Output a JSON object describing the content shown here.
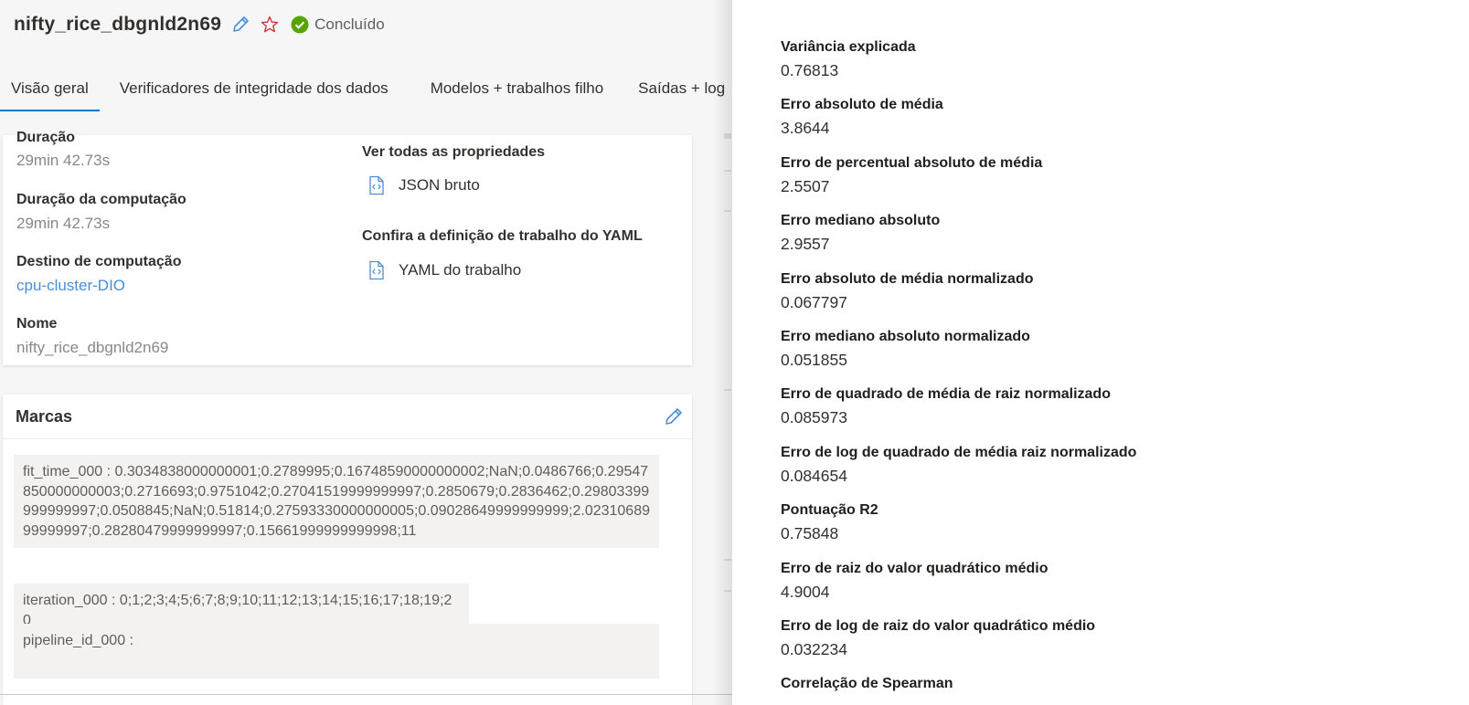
{
  "header": {
    "title": "nifty_rice_dbgnld2n69",
    "status": "Concluído",
    "edit_icon": "pencil-icon",
    "favorite_icon": "star-icon",
    "status_icon": "check-circle-icon",
    "colors": {
      "accent": "#0078d4",
      "link": "#4a8fd8",
      "success": "#57a300",
      "star": "#d13438"
    }
  },
  "tabs": [
    {
      "label": "Visão geral",
      "active": true
    },
    {
      "label": "Verificadores de integridade dos dados"
    },
    {
      "label": "Modelos + trabalhos filho"
    },
    {
      "label": "Saídas + log"
    }
  ],
  "properties": {
    "duration_label": "Duração",
    "duration_value": "29min 42.73s",
    "compute_duration_label": "Duração da computação",
    "compute_duration_value": "29min 42.73s",
    "compute_target_label": "Destino de computação",
    "compute_target_value": "cpu-cluster-DIO",
    "name_label": "Nome",
    "name_value": "nifty_rice_dbgnld2n69",
    "see_all_label": "Ver todas as propriedades",
    "raw_json_label": "JSON bruto",
    "yaml_heading": "Confira a definição de trabalho do YAML",
    "yaml_link_label": "YAML do trabalho"
  },
  "tags": {
    "heading": "Marcas",
    "items": [
      "fit_time_000 : 0.3034838000000001;0.2789995;0.16748590000000002;NaN;0.0486766;0.29547850000000003;0.2716693;0.9751042;0.27041519999999997;0.2850679;0.2836462;0.29803399999999997;0.0508845;NaN;0.51814;0.27593330000000005;0.09028649999999999;2.0231068999999997;0.28280479999999997;0.15661999999999998;11",
      "iteration_000 : 0;1;2;3;4;5;6;7;8;9;10;11;12;13;14;15;16;17;18;19;20",
      "pipeline_id_000 :"
    ]
  },
  "metrics": [
    {
      "name": "Variância explicada",
      "value": "0.76813"
    },
    {
      "name": "Erro absoluto de média",
      "value": "3.8644"
    },
    {
      "name": "Erro de percentual absoluto de média",
      "value": "2.5507"
    },
    {
      "name": "Erro mediano absoluto",
      "value": "2.9557"
    },
    {
      "name": "Erro absoluto de média normalizado",
      "value": "0.067797"
    },
    {
      "name": "Erro mediano absoluto normalizado",
      "value": "0.051855"
    },
    {
      "name": "Erro de quadrado de média de raiz normalizado",
      "value": "0.085973"
    },
    {
      "name": "Erro de log de quadrado de média raiz normalizado",
      "value": "0.084654"
    },
    {
      "name": "Pontuação R2",
      "value": "0.75848"
    },
    {
      "name": "Erro de raiz do valor quadrático médio",
      "value": "4.9004"
    },
    {
      "name": "Erro de log de raiz do valor quadrático médio",
      "value": "0.032234"
    },
    {
      "name": "Correlação de Spearman",
      "value": ""
    }
  ]
}
